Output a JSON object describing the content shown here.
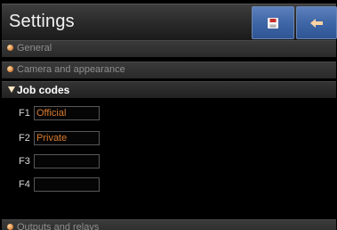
{
  "header": {
    "title": "Settings",
    "save_button_icon": "floppy-disk-icon",
    "back_button_icon": "arrow-left-icon"
  },
  "sections": {
    "general": "General",
    "camera": "Camera and appearance",
    "job_codes": "Job codes",
    "outputs": "Outputs and relays"
  },
  "job_codes": [
    {
      "key": "F1",
      "value": "Official"
    },
    {
      "key": "F2",
      "value": "Private"
    },
    {
      "key": "F3",
      "value": ""
    },
    {
      "key": "F4",
      "value": ""
    }
  ],
  "colors": {
    "accent_button": "#3f66a6",
    "value_text": "#d97a2e",
    "bullet": "#d7803a"
  }
}
